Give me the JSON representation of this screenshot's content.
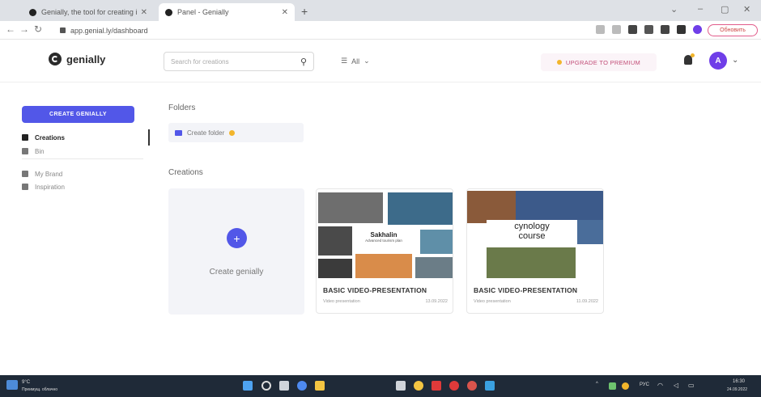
{
  "browser": {
    "tabs": [
      {
        "title": "Genially, the tool for creating i...",
        "active": false
      },
      {
        "title": "Panel - Genially",
        "active": true
      }
    ],
    "url": "app.genial.ly/dashboard",
    "profile_label": "Обновить"
  },
  "app": {
    "logo_text": "genially",
    "search_placeholder": "Search for creations",
    "filter_label": "All",
    "upgrade_label": "UPGRADE TO PREMIUM",
    "avatar_initial": "A"
  },
  "sidebar": {
    "create_label": "CREATE GENIALLY",
    "items": [
      {
        "label": "Creations",
        "icon": "grid-icon",
        "active": true
      },
      {
        "label": "Bin",
        "icon": "trash-icon",
        "active": false
      },
      {
        "label": "My Brand",
        "icon": "brand-icon",
        "active": false
      },
      {
        "label": "Inspiration",
        "icon": "inspiration-icon",
        "active": false
      }
    ]
  },
  "main": {
    "folders_title": "Folders",
    "create_folder_label": "Create folder",
    "creations_title": "Creations",
    "create_genially_label": "Create genially",
    "cards": [
      {
        "title": "BASIC VIDEO-PRESENTATION",
        "type": "Video presentation",
        "date": "13.09.2022",
        "thumb_heading": "Sakhalin",
        "thumb_sub": "Advanced tourism plan"
      },
      {
        "title": "BASIC VIDEO-PRESENTATION",
        "type": "Video presentation",
        "date": "11.09.2022",
        "thumb_heading": "cynology",
        "thumb_heading2": "course"
      }
    ]
  },
  "taskbar": {
    "weather_temp": "9°C",
    "weather_desc": "Преимущ. облачно",
    "lang": "РУС",
    "time": "16:30",
    "date": "24.09.2022"
  },
  "colors": {
    "accent": "#5257e8",
    "avatar": "#6f3ee8",
    "upgrade_text": "#c24d77",
    "taskbar": "#1f2a38"
  }
}
